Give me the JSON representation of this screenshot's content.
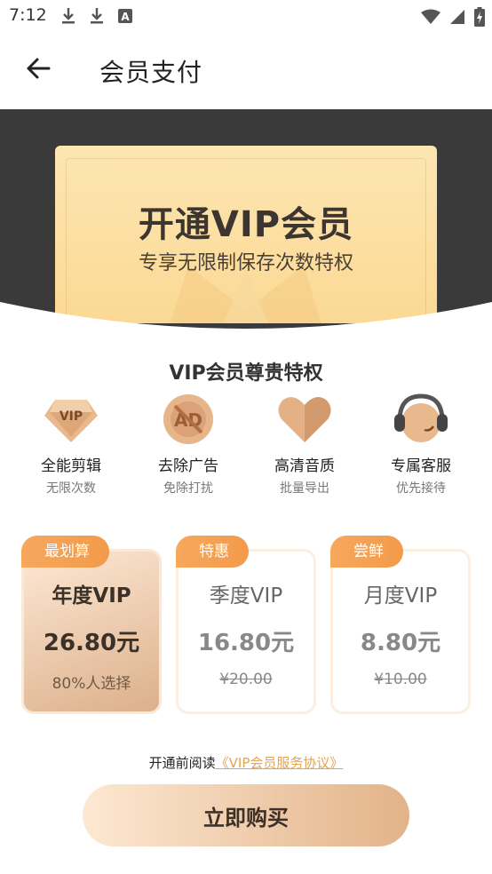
{
  "status_bar": {
    "time": "7:12",
    "left_icons": [
      "download-icon",
      "download-icon",
      "font-icon"
    ],
    "right_icons": [
      "wifi-icon",
      "signal-icon",
      "battery-charging-icon"
    ]
  },
  "header": {
    "title": "会员支付"
  },
  "hero": {
    "title": "开通VIP会员",
    "subtitle": "专享无限制保存次数特权"
  },
  "privileges": {
    "title": "VIP会员尊贵特权",
    "items": [
      {
        "icon": "vip-diamond-icon",
        "label": "全能剪辑",
        "desc": "无限次数"
      },
      {
        "icon": "no-ad-icon",
        "label": "去除广告",
        "desc": "免除打扰"
      },
      {
        "icon": "heart-icon",
        "label": "高清音质",
        "desc": "批量导出"
      },
      {
        "icon": "headset-icon",
        "label": "专属客服",
        "desc": "优先接待"
      }
    ]
  },
  "plans": [
    {
      "badge": "最划算",
      "name": "年度VIP",
      "price": "26.80元",
      "note": "80%人选择",
      "selected": true
    },
    {
      "badge": "特惠",
      "name": "季度VIP",
      "price": "16.80元",
      "original_price": "¥20.00",
      "selected": false
    },
    {
      "badge": "尝鲜",
      "name": "月度VIP",
      "price": "8.80元",
      "original_price": "¥10.00",
      "selected": false
    }
  ],
  "agreement": {
    "prefix": "开通前阅读",
    "link": "《VIP会员服务协议》"
  },
  "buy_button": "立即购买",
  "colors": {
    "accent_orange": "#f39a4a",
    "gold_light": "#fde8d2",
    "gold_dark": "#e2b389",
    "link": "#e6a44f",
    "hero_dark": "#3a3a3a"
  }
}
